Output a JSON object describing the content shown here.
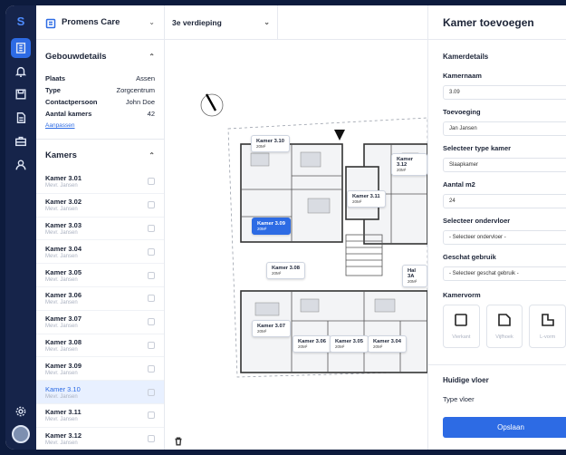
{
  "app": {
    "logo": "S"
  },
  "colors": {
    "accent": "#2d6be4",
    "rail_bg": "#16244a",
    "active_room_label": "#2d6be4"
  },
  "rail": {
    "icons": [
      "building-icon",
      "bell-icon",
      "floppy-icon",
      "document-icon",
      "briefcase-icon",
      "user-icon",
      "settings-icon"
    ]
  },
  "sidebar": {
    "building_name": "Promens Care",
    "details_title": "Gebouwdetails",
    "details": [
      {
        "key": "Plaats",
        "value": "Assen"
      },
      {
        "key": "Type",
        "value": "Zorgcentrum"
      },
      {
        "key": "Contactpersoon",
        "value": "John Doe"
      },
      {
        "key": "Aantal kamers",
        "value": "42"
      }
    ],
    "edit_link": "Aanpassen",
    "rooms_title": "Kamers",
    "rooms": [
      {
        "name": "Kamer 3.01",
        "sub": "Mevr. Jansen"
      },
      {
        "name": "Kamer 3.02",
        "sub": "Mevr. Jansen"
      },
      {
        "name": "Kamer 3.03",
        "sub": "Mevr. Jansen"
      },
      {
        "name": "Kamer 3.04",
        "sub": "Mevr. Jansen"
      },
      {
        "name": "Kamer 3.05",
        "sub": "Mevr. Jansen"
      },
      {
        "name": "Kamer 3.06",
        "sub": "Mevr. Jansen"
      },
      {
        "name": "Kamer 3.07",
        "sub": "Mevr. Jansen"
      },
      {
        "name": "Kamer 3.08",
        "sub": "Mevr. Jansen"
      },
      {
        "name": "Kamer 3.09",
        "sub": "Mevr. Jansen"
      },
      {
        "name": "Kamer 3.10",
        "sub": "Mevr. Jansen"
      },
      {
        "name": "Kamer 3.11",
        "sub": "Mevr. Jansen"
      },
      {
        "name": "Kamer 3.12",
        "sub": "Mevr. Jansen"
      }
    ],
    "selected_room": "Kamer 3.10"
  },
  "map": {
    "floor": "3e verdieping",
    "room_labels": [
      {
        "name": "Kamer 3.10",
        "area": "20M²"
      },
      {
        "name": "Kamer 3.12",
        "area": "20M²"
      },
      {
        "name": "Kamer 3.11",
        "area": "20M²"
      },
      {
        "name": "Kamer 3.09",
        "area": "20M²"
      },
      {
        "name": "Kamer 3.08",
        "area": "20M²"
      },
      {
        "name": "Hal 3A",
        "area": "20M²"
      },
      {
        "name": "Kamer 3.07",
        "area": "20M²"
      },
      {
        "name": "Kamer 3.06",
        "area": "20M²"
      },
      {
        "name": "Kamer 3.05",
        "area": "20M²"
      },
      {
        "name": "Kamer 3.04",
        "area": "20M²"
      }
    ]
  },
  "panel": {
    "title": "Kamer toevoegen",
    "section": "Kamerdetails",
    "fields": [
      {
        "label": "Kamernaam",
        "value": "3.09"
      },
      {
        "label": "Toevoeging",
        "value": "Jan Jansen"
      },
      {
        "label": "Selecteer type kamer",
        "value": "Slaapkamer"
      },
      {
        "label": "Aantal m2",
        "value": "24"
      },
      {
        "label": "Selecteer ondervloer",
        "value": "- Selecteer ondervloer -"
      },
      {
        "label": "Geschat gebruik",
        "value": "- Selecteer geschat gebruik -"
      }
    ],
    "shape_label": "Kamervorm",
    "shapes": [
      "Vierkant",
      "Vijfhoek",
      "L-vorm"
    ],
    "current_floor_title": "Huidige vloer",
    "floor_type_label": "Type vloer",
    "save_label": "Opslaan"
  }
}
